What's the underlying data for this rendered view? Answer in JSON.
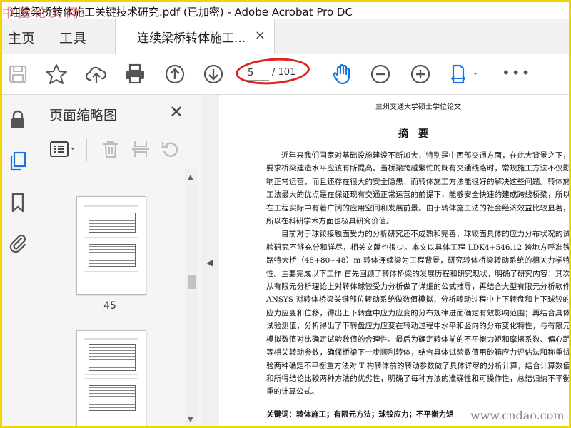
{
  "window": {
    "title": "连续梁桥转体施工关键技术研究.pdf (已加密) - Adobe Acrobat Pro DC",
    "watermark": "中 国 论 文 网"
  },
  "tabs": {
    "home": "主页",
    "tools": "工具",
    "document": "连续梁桥转体施工...",
    "close": "×"
  },
  "toolbar": {
    "icons": [
      "save-icon",
      "star-icon",
      "cloud-upload-icon",
      "print-icon",
      "arrow-up-icon",
      "arrow-down-icon",
      "hand-icon",
      "zoom-out-icon",
      "zoom-in-icon",
      "fit-page-icon",
      "more-icon"
    ],
    "current_page": "5",
    "page_total": "/ 101",
    "more": "•••"
  },
  "sidebar": {
    "title": "页面缩略图",
    "close": "✕",
    "thumbnails": [
      {
        "label": "45"
      },
      {
        "label": ""
      }
    ]
  },
  "document": {
    "header": "兰州交通大学硕士学位论文",
    "heading": "摘要",
    "paragraphs": [
      "近年来我们国家对基础设施建设不断加大，特别是中西部交通方面，在此大背景之下，要求桥梁建造水平应该有所提高。当桥梁跨越繁忙的既有交通线路时，常规施工方法不仅影响正常运营，而且还存在很大的安全隐患，而转体施工方法能很好的解决这些问题。转体施工法最大的优点是在保证现有交通正常运营的前提下，能够安全快速的建成跨线桥梁，所以在工程实际中有着广阔的应用空间和发展前景。由于转体施工法的社会经济效益比较显著，所以在科研学术方面也极具研究价值。",
      "目前对于球铰接触面受力的分析研究还不成熟和完善，球铰面具体的应力分布状况的试验研究不够充分和详尽，相关文献也很少。本文以具体工程 LDK4+546.12 跨地方呼准铁路特大桥（48+80+48）m 转体连续梁为工程背景，研究转体桥梁转动系统的相关力学特性。主要完成以下工作:首先回顾了转体桥梁的发展历程和研究现状，明确了研究内容；其次从有限元分析理论上对转体球铰受力分析做了详细的公式推导，再结合大型有限元分析软件 ANSYS 对转体桥梁关键部位转动系统做数值模拟，分析转动过程中上下转盘和上下球铰的应力应变和位移，得出上下转盘中应力应变的分布规律进而确定有效影响范围；再结合具体试验测值，分析得出了下转盘应力应变在转动过程中水平和竖向的分布变化特性，与有限元模拟数值对比确定试验数值的合理性。最后为确定转体前的不平衡力矩和摩擦系数、偏心距等相关转动参数，确保桥梁下一步顺利转体，结合具体试验数值用砂箱应力评估法和称重试验两种确定不平衡重方法对 T 构转体前的转动参数做了具体详尽的分析计算，结合计算数值和所得结论比较两种方法的优劣性，明确了每种方法的准确性和可操作性，总结归纳不平衡重的计算公式。"
    ],
    "keywords": "关键词：转体施工；有限元方法；球铰应力；不平衡力矩"
  },
  "overlay": {
    "site_watermark": "www.cndao.com"
  }
}
